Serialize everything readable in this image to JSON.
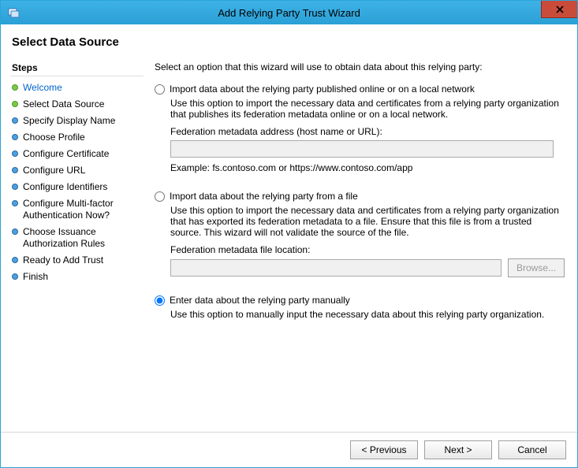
{
  "title": "Add Relying Party Trust Wizard",
  "header": "Select Data Source",
  "steps_heading": "Steps",
  "steps": [
    {
      "label": "Welcome",
      "state": "done",
      "link": true
    },
    {
      "label": "Select Data Source",
      "state": "done",
      "link": false
    },
    {
      "label": "Specify Display Name",
      "state": "todo",
      "link": false
    },
    {
      "label": "Choose Profile",
      "state": "todo",
      "link": false
    },
    {
      "label": "Configure Certificate",
      "state": "todo",
      "link": false
    },
    {
      "label": "Configure URL",
      "state": "todo",
      "link": false
    },
    {
      "label": "Configure Identifiers",
      "state": "todo",
      "link": false
    },
    {
      "label": "Configure Multi-factor Authentication Now?",
      "state": "todo",
      "link": false
    },
    {
      "label": "Choose Issuance Authorization Rules",
      "state": "todo",
      "link": false
    },
    {
      "label": "Ready to Add Trust",
      "state": "todo",
      "link": false
    },
    {
      "label": "Finish",
      "state": "todo",
      "link": false
    }
  ],
  "content": {
    "intro": "Select an option that this wizard will use to obtain data about this relying party:",
    "opt1": {
      "label": "Import data about the relying party published online or on a local network",
      "desc": "Use this option to import the necessary data and certificates from a relying party organization that publishes its federation metadata online or on a local network.",
      "field_label": "Federation metadata address (host name or URL):",
      "value": "",
      "example": "Example: fs.contoso.com or https://www.contoso.com/app"
    },
    "opt2": {
      "label": "Import data about the relying party from a file",
      "desc": "Use this option to import the necessary data and certificates from a relying party organization that has exported its federation metadata to a file. Ensure that this file is from a trusted source.  This wizard will not validate the source of the file.",
      "field_label": "Federation metadata file location:",
      "value": "",
      "browse": "Browse..."
    },
    "opt3": {
      "label": "Enter data about the relying party manually",
      "desc": "Use this option to manually input the necessary data about this relying party organization."
    },
    "selected": "opt3"
  },
  "footer": {
    "previous": "< Previous",
    "next": "Next >",
    "cancel": "Cancel"
  }
}
